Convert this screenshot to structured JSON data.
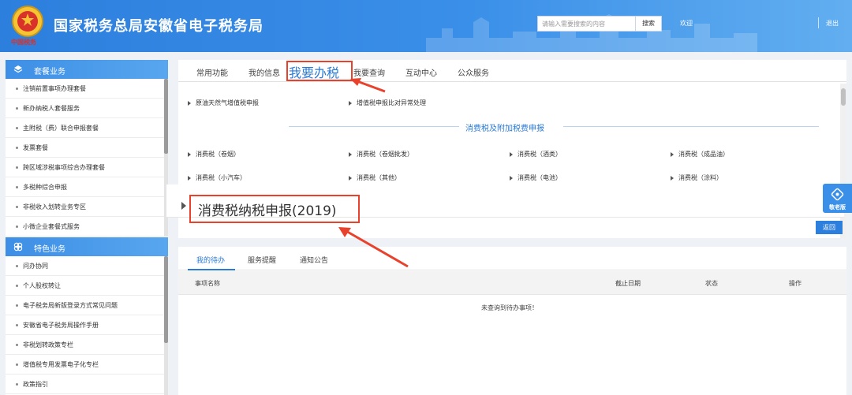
{
  "header": {
    "emblem_caption": "中国税务",
    "title": "国家税务总局安徽省电子税务局",
    "search_placeholder": "请输入需要搜索的内容",
    "search_button": "搜索",
    "welcome": "欢迎",
    "logout": "退出"
  },
  "sidebar": {
    "sections": [
      {
        "label": "套餐业务",
        "icon": "layers-icon",
        "items": [
          "注销前置事项办理套餐",
          "新办纳税人套餐服务",
          "主附税（费）联合申报套餐",
          "发票套餐",
          "跨区域涉税事项综合办理套餐",
          "多税种综合申报",
          "非税收入划转业务专区",
          "小微企业套餐式服务"
        ]
      },
      {
        "label": "特色业务",
        "icon": "clover-icon",
        "items": [
          "问办协同",
          "个人股权转让",
          "电子税务局新版登录方式常见问题",
          "安徽省电子税务局操作手册",
          "非税划转政策专栏",
          "增值税专用发票电子化专栏",
          "政策指引"
        ]
      }
    ]
  },
  "main": {
    "tabs": [
      "常用功能",
      "我的信息",
      "我要办税",
      "我要查询",
      "互动中心",
      "公众服务"
    ],
    "active_tab": "我要办税",
    "top_links": [
      "原油天然气增值税申报",
      "增值税申报比对异常处理"
    ],
    "section_title": "消费税及附加税费申报",
    "grid_links": [
      "消费税（卷烟）",
      "消费税（卷烟批发）",
      "消费税（酒类）",
      "消费税（成品油）",
      "消费税（小汽车）",
      "消费税（其他）",
      "消费税（电池）",
      "消费税（涂料）"
    ],
    "callout_text": "消费税纳税申报(2019)",
    "back_button": "返回",
    "care_button": "敬老版"
  },
  "bottom": {
    "tabs": [
      "我的待办",
      "服务提醒",
      "通知公告"
    ],
    "columns": [
      "事项名称",
      "截止日期",
      "状态",
      "操作"
    ],
    "empty_message": "未查询到待办事项！"
  },
  "colors": {
    "header_blue": "#2d7fdd",
    "accent_blue": "#2a7bd8",
    "highlight_red": "#e8412c"
  }
}
